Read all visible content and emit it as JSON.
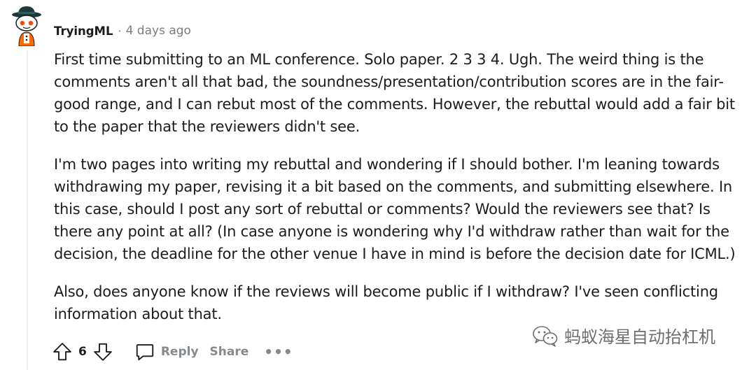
{
  "comment": {
    "author": "TryingML",
    "separator": "·",
    "timestamp": "4 days ago",
    "paragraphs": [
      "First time submitting to an ML conference. Solo paper. 2 3 3 4. Ugh. The weird thing is the comments aren't all that bad, the soundness/presentation/contribution scores are in the fair-good range, and I can rebut most of the comments. However, the rebuttal would add a fair bit to the paper that the reviewers didn't see.",
      "I'm two pages into writing my rebuttal and wondering if I should bother. I'm leaning towards withdrawing my paper, revising it a bit based on the comments, and submitting elsewhere. In this case, should I post any sort of rebuttal or comments? Would the reviewers see that? Is there any point at all? (In case anyone is wondering why I'd withdraw rather than wait for the decision, the deadline for the other venue I have in mind is before the decision date for ICML.)",
      "Also, does anyone know if the reviews will become public if I withdraw? I've seen conflicting information about that."
    ],
    "vote_count": "6",
    "reply_label": "Reply",
    "share_label": "Share",
    "more_label": "•••"
  },
  "watermark": {
    "text": "蚂蚁海星自动抬杠机"
  },
  "colors": {
    "text": "#1c1c1c",
    "meta": "#7c7c7c",
    "action": "#878a8c",
    "thread_line": "#edeff1"
  },
  "icons": [
    "avatar-snoo-icon",
    "upvote-icon",
    "downvote-icon",
    "comment-icon",
    "more-icon",
    "wechat-icon"
  ]
}
